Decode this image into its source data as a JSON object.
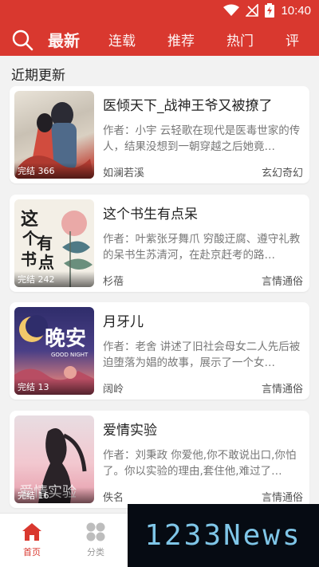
{
  "status_bar": {
    "time": "10:40"
  },
  "tabs": [
    {
      "label": "最新",
      "active": true
    },
    {
      "label": "连载"
    },
    {
      "label": "推荐"
    },
    {
      "label": "热门"
    },
    {
      "label": "评"
    }
  ],
  "section_title": "近期更新",
  "books": [
    {
      "title": "医倾天下_战神王爷又被撩了",
      "badge": "完结 366",
      "desc": "作者：小宇 云轻歌在现代是医毒世家的传人，结果没想到一朝穿越之后她竟…",
      "author": "如澜若溪",
      "genre": "玄幻奇幻"
    },
    {
      "title": "这个书生有点呆",
      "badge": "完结 242",
      "desc": "作者：叶紫张牙舞爪 穷酸迂腐、遵守礼教的呆书生苏清河，在赴京赶考的路…",
      "author": "杉蓓",
      "genre": "言情通俗",
      "cover_text": "这个书生有点呆"
    },
    {
      "title": "月牙儿",
      "badge": "完结 13",
      "desc": "作者：老舍 讲述了旧社会母女二人先后被迫堕落为娼的故事，展示了一个女…",
      "author": "阔岭",
      "genre": "言情通俗",
      "cover_text": "晚安",
      "cover_sub": "GOOD NIGHT"
    },
    {
      "title": "爱情实验",
      "badge": "完结 16",
      "desc": "作者：刘秉政 你爱他,你不敢说出口,你怕了。你以实验的理由,套住他,难过了…",
      "author": "佚名",
      "genre": "言情通俗",
      "cover_text": "爱情实验"
    }
  ],
  "bottom_nav": [
    {
      "label": "首页",
      "active": true
    },
    {
      "label": "分类"
    }
  ],
  "watermark": "1233News",
  "colors": {
    "brand": "#d9382f"
  }
}
